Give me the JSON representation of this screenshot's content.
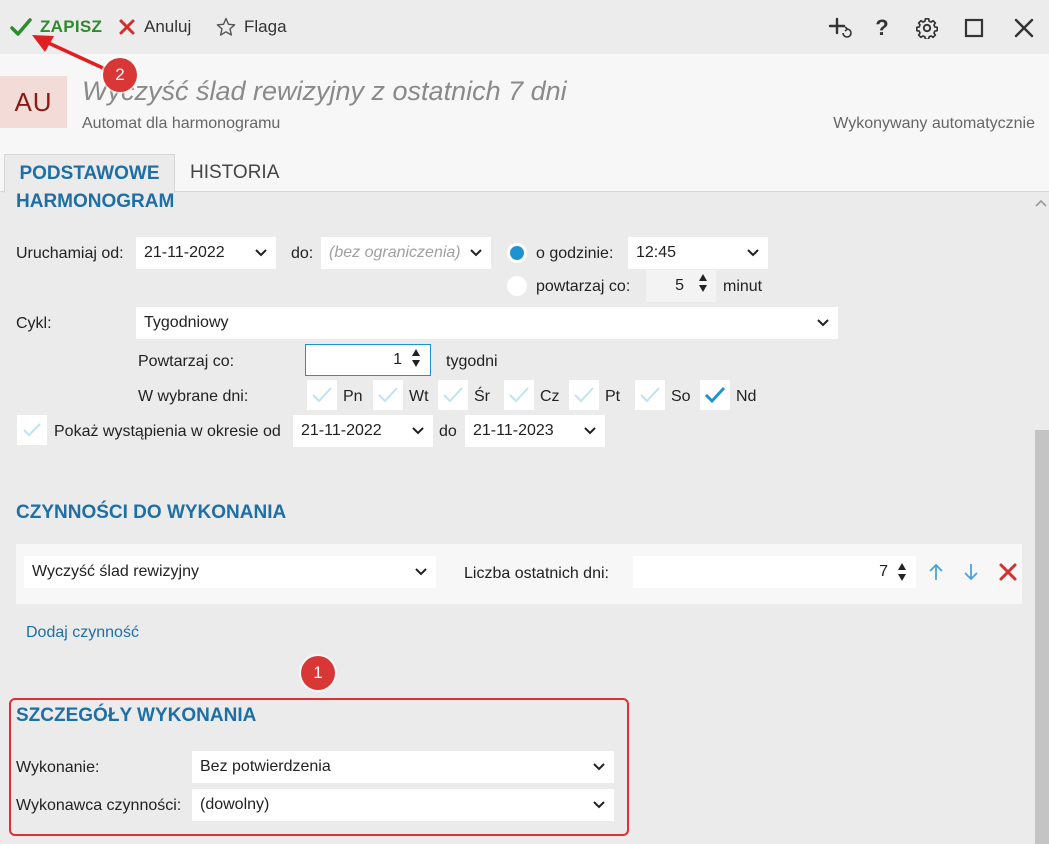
{
  "toolbar": {
    "save_label": "ZAPISZ",
    "cancel_label": "Anuluj",
    "flag_label": "Flaga"
  },
  "header": {
    "avatar": "AU",
    "title": "Wyczyść ślad rewizyjny z ostatnich 7 dni",
    "subtitle": "Automat dla harmonogramu",
    "mode": "Wykonywany automatycznie"
  },
  "tabs": [
    {
      "label": "PODSTAWOWE",
      "active": true
    },
    {
      "label": "HISTORIA",
      "active": false
    }
  ],
  "schedule": {
    "heading": "HARMONOGRAM",
    "start_label": "Uruchamiaj od:",
    "start_value": "21-11-2022",
    "end_label": "do:",
    "end_placeholder": "(bez ograniczenia)",
    "at_time_label": "o godzinie:",
    "time_value": "12:45",
    "repeat_label": "powtarzaj co:",
    "repeat_value": "5",
    "repeat_unit": "minut",
    "cycle_label": "Cykl:",
    "cycle_value": "Tygodniowy",
    "repeat_every_label": "Powtarzaj co:",
    "repeat_every_value": "1",
    "repeat_every_unit": "tygodni",
    "days_label": "W wybrane dni:",
    "days": [
      {
        "label": "Pn",
        "checked": false
      },
      {
        "label": "Wt",
        "checked": false
      },
      {
        "label": "Śr",
        "checked": false
      },
      {
        "label": "Cz",
        "checked": false
      },
      {
        "label": "Pt",
        "checked": false
      },
      {
        "label": "So",
        "checked": false
      },
      {
        "label": "Nd",
        "checked": true
      }
    ],
    "show_occurrences_label": "Pokaż wystąpienia w okresie od",
    "occ_from": "21-11-2022",
    "occ_to_label": "do",
    "occ_to": "21-11-2023"
  },
  "actions": {
    "heading": "CZYNNOŚCI DO WYKONANIA",
    "action_value": "Wyczyść ślad rewizyjny",
    "days_count_label": "Liczba ostatnich dni:",
    "days_count_value": "7",
    "add_link": "Dodaj czynność"
  },
  "details": {
    "heading": "SZCZEGÓŁY WYKONANIA",
    "execution_label": "Wykonanie:",
    "execution_value": "Bez potwierdzenia",
    "executor_label": "Wykonawca czynności:",
    "executor_value": "(dowolny)"
  },
  "annotations": {
    "badge_1": "1",
    "badge_2": "2"
  },
  "colors": {
    "accent_blue": "#1d6fa5",
    "save_green": "#2e8b2e",
    "annotation_red": "#d93636"
  }
}
